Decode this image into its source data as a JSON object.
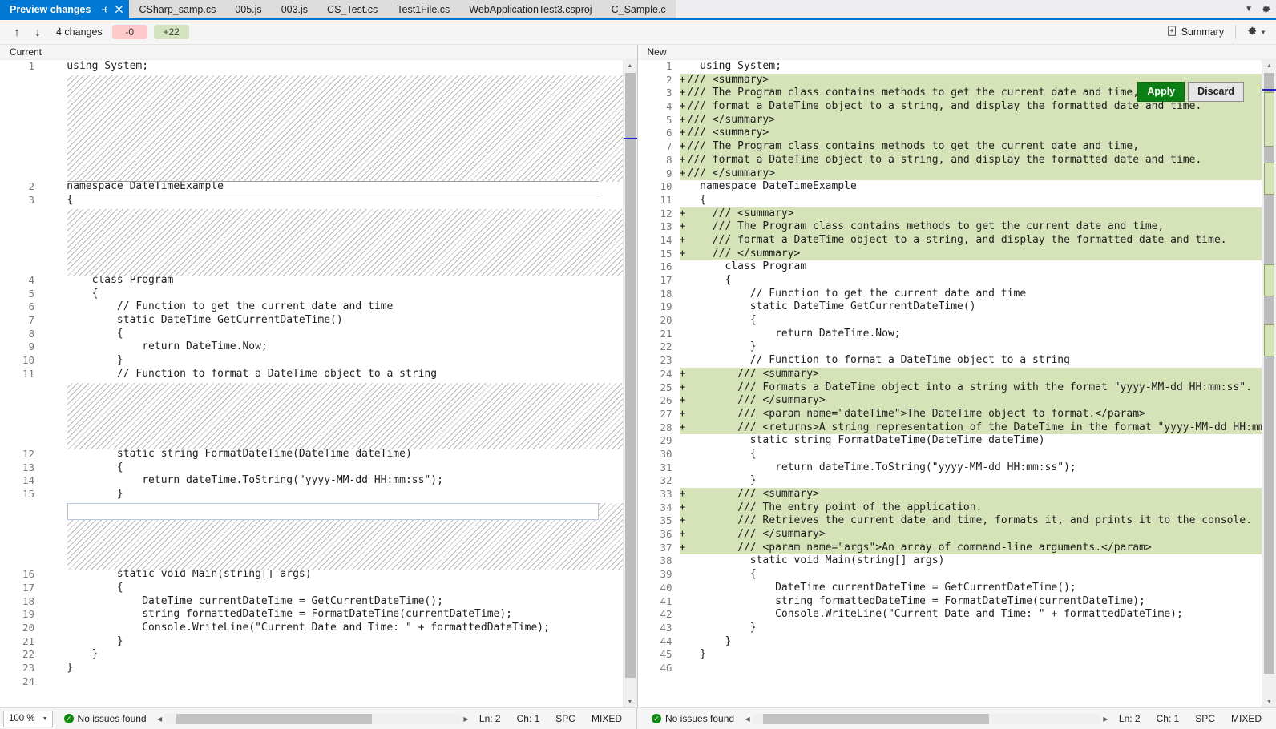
{
  "tabs": [
    {
      "label": "Preview changes",
      "active": true,
      "pin_icon": "pin-icon",
      "close_icon": "close-icon"
    },
    {
      "label": "CSharp_samp.cs",
      "active": false
    },
    {
      "label": "005.js",
      "active": false
    },
    {
      "label": "003.js",
      "active": false
    },
    {
      "label": "CS_Test.cs",
      "active": false
    },
    {
      "label": "Test1File.cs",
      "active": false
    },
    {
      "label": "WebApplicationTest3.csproj",
      "active": false
    },
    {
      "label": "C_Sample.c",
      "active": false
    }
  ],
  "tabbar": {
    "overflow_icon": "chevron-down-icon",
    "settings_icon": "gear-icon"
  },
  "toolbar": {
    "prev_icon": "arrow-up-icon",
    "next_icon": "arrow-down-icon",
    "changes_label": "4 changes",
    "deletions_badge": "-0",
    "additions_badge": "+22",
    "summary_label": "Summary",
    "summary_icon": "document-summary-icon",
    "gear_icon": "gear-icon",
    "gear_caret": "chevron-down-icon"
  },
  "actions": {
    "apply_label": "Apply",
    "discard_label": "Discard"
  },
  "colors": {
    "accent": "#0078d4",
    "added_bg": "#d6e3b9",
    "apply_green": "#0c8014",
    "badge_del": "#ffc9c9",
    "badge_add": "#d3e3bd",
    "marker_blue": "#2121c4"
  },
  "left_pane": {
    "header": "Current",
    "lines": [
      {
        "n": "1",
        "text": "    using System;"
      },
      {
        "n": "",
        "text": "",
        "hatch": true
      },
      {
        "n": "",
        "text": "",
        "hatch": true
      },
      {
        "n": "",
        "text": "",
        "hatch": true
      },
      {
        "n": "",
        "text": "",
        "hatch": true
      },
      {
        "n": "",
        "text": "",
        "hatch": true
      },
      {
        "n": "",
        "text": "",
        "hatch": true
      },
      {
        "n": "",
        "text": "",
        "hatch": true
      },
      {
        "n": "",
        "text": "",
        "hatch": true
      },
      {
        "n": "2",
        "text": "    namespace DateTimeExample"
      },
      {
        "n": "3",
        "text": "    {"
      },
      {
        "n": "",
        "text": "",
        "hatch": true
      },
      {
        "n": "",
        "text": "",
        "hatch": true
      },
      {
        "n": "",
        "text": "",
        "hatch": true
      },
      {
        "n": "",
        "text": "",
        "hatch": true
      },
      {
        "n": "",
        "text": "",
        "hatch": true
      },
      {
        "n": "4",
        "text": "        class Program"
      },
      {
        "n": "5",
        "text": "        {"
      },
      {
        "n": "6",
        "text": "            // Function to get the current date and time"
      },
      {
        "n": "7",
        "text": "            static DateTime GetCurrentDateTime()"
      },
      {
        "n": "8",
        "text": "            {"
      },
      {
        "n": "9",
        "text": "                return DateTime.Now;"
      },
      {
        "n": "10",
        "text": "            }"
      },
      {
        "n": "11",
        "text": "            // Function to format a DateTime object to a string"
      },
      {
        "n": "",
        "text": "",
        "hatch": true
      },
      {
        "n": "",
        "text": "",
        "hatch": true
      },
      {
        "n": "",
        "text": "",
        "hatch": true
      },
      {
        "n": "",
        "text": "",
        "hatch": true
      },
      {
        "n": "",
        "text": "",
        "hatch": true
      },
      {
        "n": "12",
        "text": "            static string FormatDateTime(DateTime dateTime)"
      },
      {
        "n": "13",
        "text": "            {"
      },
      {
        "n": "14",
        "text": "                return dateTime.ToString(\"yyyy-MM-dd HH:mm:ss\");"
      },
      {
        "n": "15",
        "text": "            }"
      },
      {
        "n": "",
        "text": "",
        "hatch": true
      },
      {
        "n": "",
        "text": "",
        "hatch": true
      },
      {
        "n": "",
        "text": "",
        "hatch": true
      },
      {
        "n": "",
        "text": "",
        "hatch": true
      },
      {
        "n": "",
        "text": "",
        "hatch": true
      },
      {
        "n": "16",
        "text": "            static void Main(string[] args)"
      },
      {
        "n": "17",
        "text": "            {"
      },
      {
        "n": "18",
        "text": "                DateTime currentDateTime = GetCurrentDateTime();"
      },
      {
        "n": "19",
        "text": "                string formattedDateTime = FormatDateTime(currentDateTime);"
      },
      {
        "n": "20",
        "text": "                Console.WriteLine(\"Current Date and Time: \" + formattedDateTime);"
      },
      {
        "n": "21",
        "text": "            }"
      },
      {
        "n": "22",
        "text": "        }"
      },
      {
        "n": "23",
        "text": "    }"
      },
      {
        "n": "24",
        "text": ""
      }
    ],
    "status": {
      "zoom": "100 %",
      "zoom_caret": "chevron-down-icon",
      "issues": "No issues found",
      "issues_icon": "check-circle-icon",
      "line": "Ln: 2",
      "col": "Ch: 1",
      "spaces": "SPC",
      "encoding": "MIXED"
    }
  },
  "right_pane": {
    "header": "New",
    "lines": [
      {
        "n": "1",
        "m": "",
        "text": "  using System;",
        "added": false
      },
      {
        "n": "2",
        "m": "+",
        "text": "/// <summary>",
        "added": true
      },
      {
        "n": "3",
        "m": "+",
        "text": "/// The Program class contains methods to get the current date and time,",
        "added": true
      },
      {
        "n": "4",
        "m": "+",
        "text": "/// format a DateTime object to a string, and display the formatted date and time.",
        "added": true
      },
      {
        "n": "5",
        "m": "+",
        "text": "/// </summary>",
        "added": true
      },
      {
        "n": "6",
        "m": "+",
        "text": "/// <summary>",
        "added": true
      },
      {
        "n": "7",
        "m": "+",
        "text": "/// The Program class contains methods to get the current date and time,",
        "added": true
      },
      {
        "n": "8",
        "m": "+",
        "text": "/// format a DateTime object to a string, and display the formatted date and time.",
        "added": true
      },
      {
        "n": "9",
        "m": "+",
        "text": "/// </summary>",
        "added": true
      },
      {
        "n": "10",
        "m": "",
        "text": "  namespace DateTimeExample",
        "added": false
      },
      {
        "n": "11",
        "m": "",
        "text": "  {",
        "added": false
      },
      {
        "n": "12",
        "m": "+",
        "text": "    /// <summary>",
        "added": true
      },
      {
        "n": "13",
        "m": "+",
        "text": "    /// The Program class contains methods to get the current date and time,",
        "added": true
      },
      {
        "n": "14",
        "m": "+",
        "text": "    /// format a DateTime object to a string, and display the formatted date and time.",
        "added": true
      },
      {
        "n": "15",
        "m": "+",
        "text": "    /// </summary>",
        "added": true
      },
      {
        "n": "16",
        "m": "",
        "text": "      class Program",
        "added": false
      },
      {
        "n": "17",
        "m": "",
        "text": "      {",
        "added": false
      },
      {
        "n": "18",
        "m": "",
        "text": "          // Function to get the current date and time",
        "added": false
      },
      {
        "n": "19",
        "m": "",
        "text": "          static DateTime GetCurrentDateTime()",
        "added": false
      },
      {
        "n": "20",
        "m": "",
        "text": "          {",
        "added": false
      },
      {
        "n": "21",
        "m": "",
        "text": "              return DateTime.Now;",
        "added": false
      },
      {
        "n": "22",
        "m": "",
        "text": "          }",
        "added": false
      },
      {
        "n": "23",
        "m": "",
        "text": "          // Function to format a DateTime object to a string",
        "added": false
      },
      {
        "n": "24",
        "m": "+",
        "text": "        /// <summary>",
        "added": true
      },
      {
        "n": "25",
        "m": "+",
        "text": "        /// Formats a DateTime object into a string with the format \"yyyy-MM-dd HH:mm:ss\".",
        "added": true
      },
      {
        "n": "26",
        "m": "+",
        "text": "        /// </summary>",
        "added": true
      },
      {
        "n": "27",
        "m": "+",
        "text": "        /// <param name=\"dateTime\">The DateTime object to format.</param>",
        "added": true
      },
      {
        "n": "28",
        "m": "+",
        "text": "        /// <returns>A string representation of the DateTime in the format \"yyyy-MM-dd HH:mm:ss\".</returns>",
        "added": true
      },
      {
        "n": "29",
        "m": "",
        "text": "          static string FormatDateTime(DateTime dateTime)",
        "added": false
      },
      {
        "n": "30",
        "m": "",
        "text": "          {",
        "added": false
      },
      {
        "n": "31",
        "m": "",
        "text": "              return dateTime.ToString(\"yyyy-MM-dd HH:mm:ss\");",
        "added": false
      },
      {
        "n": "32",
        "m": "",
        "text": "          }",
        "added": false
      },
      {
        "n": "33",
        "m": "+",
        "text": "        /// <summary>",
        "added": true
      },
      {
        "n": "34",
        "m": "+",
        "text": "        /// The entry point of the application.",
        "added": true
      },
      {
        "n": "35",
        "m": "+",
        "text": "        /// Retrieves the current date and time, formats it, and prints it to the console.",
        "added": true
      },
      {
        "n": "36",
        "m": "+",
        "text": "        /// </summary>",
        "added": true
      },
      {
        "n": "37",
        "m": "+",
        "text": "        /// <param name=\"args\">An array of command-line arguments.</param>",
        "added": true
      },
      {
        "n": "38",
        "m": "",
        "text": "          static void Main(string[] args)",
        "added": false
      },
      {
        "n": "39",
        "m": "",
        "text": "          {",
        "added": false
      },
      {
        "n": "40",
        "m": "",
        "text": "              DateTime currentDateTime = GetCurrentDateTime();",
        "added": false
      },
      {
        "n": "41",
        "m": "",
        "text": "              string formattedDateTime = FormatDateTime(currentDateTime);",
        "added": false
      },
      {
        "n": "42",
        "m": "",
        "text": "              Console.WriteLine(\"Current Date and Time: \" + formattedDateTime);",
        "added": false
      },
      {
        "n": "43",
        "m": "",
        "text": "          }",
        "added": false
      },
      {
        "n": "44",
        "m": "",
        "text": "      }",
        "added": false
      },
      {
        "n": "45",
        "m": "",
        "text": "  }",
        "added": false
      },
      {
        "n": "46",
        "m": "",
        "text": "",
        "added": false
      }
    ],
    "status": {
      "issues": "No issues found",
      "issues_icon": "check-circle-icon",
      "line": "Ln: 2",
      "col": "Ch: 1",
      "spaces": "SPC",
      "encoding": "MIXED"
    }
  }
}
